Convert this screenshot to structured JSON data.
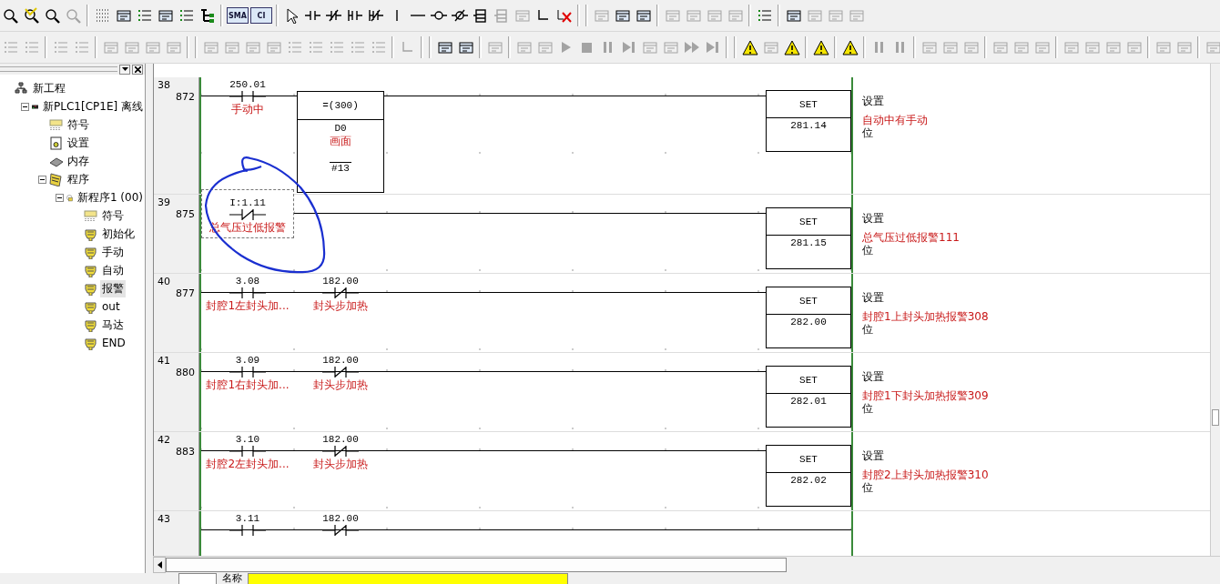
{
  "toolbars": [
    {
      "items": [
        {
          "kind": "magnifier",
          "disabled": false
        },
        {
          "kind": "find",
          "disabled": false
        },
        {
          "kind": "magnifier",
          "disabled": false
        },
        {
          "kind": "magnifier",
          "disabled": true
        },
        {
          "kind": "separator"
        },
        {
          "kind": "grid",
          "disabled": false
        },
        {
          "kind": "window",
          "disabled": false
        },
        {
          "kind": "list",
          "disabled": false
        },
        {
          "kind": "window",
          "disabled": false
        },
        {
          "kind": "list",
          "disabled": false
        },
        {
          "kind": "tree",
          "disabled": false
        },
        {
          "kind": "separator"
        },
        {
          "kind": "labeled",
          "label": "SMA",
          "disabled": false
        },
        {
          "kind": "labeled",
          "label": "CI",
          "disabled": false
        },
        {
          "kind": "separator"
        },
        {
          "kind": "pointer",
          "disabled": false
        },
        {
          "kind": "contact-no",
          "disabled": false
        },
        {
          "kind": "contact-nc",
          "disabled": false
        },
        {
          "kind": "contact-or-no",
          "disabled": false
        },
        {
          "kind": "contact-or-nc",
          "disabled": false
        },
        {
          "kind": "line-v",
          "disabled": false
        },
        {
          "kind": "line-h",
          "disabled": false
        },
        {
          "kind": "coil",
          "disabled": false
        },
        {
          "kind": "coil-nc",
          "disabled": false
        },
        {
          "kind": "instruction",
          "disabled": false
        },
        {
          "kind": "instruction",
          "disabled": true
        },
        {
          "kind": "window",
          "disabled": true
        },
        {
          "kind": "corner",
          "disabled": false
        },
        {
          "kind": "delete",
          "disabled": false
        },
        {
          "kind": "separator"
        },
        {
          "kind": "separator"
        },
        {
          "kind": "window",
          "disabled": true
        },
        {
          "kind": "window",
          "disabled": false
        },
        {
          "kind": "window",
          "disabled": false
        },
        {
          "kind": "separator"
        },
        {
          "kind": "window",
          "disabled": true
        },
        {
          "kind": "window",
          "disabled": true
        },
        {
          "kind": "window",
          "disabled": true
        },
        {
          "kind": "window",
          "disabled": true
        },
        {
          "kind": "separator"
        },
        {
          "kind": "list",
          "disabled": false
        },
        {
          "kind": "separator"
        },
        {
          "kind": "window",
          "disabled": false
        },
        {
          "kind": "window",
          "disabled": true
        },
        {
          "kind": "window",
          "disabled": true
        },
        {
          "kind": "window",
          "disabled": true
        }
      ]
    },
    {
      "items": [
        {
          "kind": "list",
          "disabled": true
        },
        {
          "kind": "list",
          "disabled": true
        },
        {
          "kind": "separator"
        },
        {
          "kind": "list",
          "disabled": true
        },
        {
          "kind": "list",
          "disabled": true
        },
        {
          "kind": "separator"
        },
        {
          "kind": "window",
          "disabled": true
        },
        {
          "kind": "window",
          "disabled": true
        },
        {
          "kind": "window",
          "disabled": true
        },
        {
          "kind": "window",
          "disabled": true
        },
        {
          "kind": "separator"
        },
        {
          "kind": "separator"
        },
        {
          "kind": "window",
          "disabled": true
        },
        {
          "kind": "window",
          "disabled": true
        },
        {
          "kind": "window",
          "disabled": true
        },
        {
          "kind": "window",
          "disabled": true
        },
        {
          "kind": "list",
          "disabled": true
        },
        {
          "kind": "list",
          "disabled": true
        },
        {
          "kind": "list",
          "disabled": true
        },
        {
          "kind": "list",
          "disabled": true
        },
        {
          "kind": "list",
          "disabled": true
        },
        {
          "kind": "separator"
        },
        {
          "kind": "corner",
          "disabled": true
        },
        {
          "kind": "separator"
        },
        {
          "kind": "separator"
        },
        {
          "kind": "window",
          "disabled": false
        },
        {
          "kind": "window",
          "disabled": false
        },
        {
          "kind": "separator"
        },
        {
          "kind": "window",
          "disabled": true
        },
        {
          "kind": "separator"
        },
        {
          "kind": "window",
          "disabled": true
        },
        {
          "kind": "window",
          "disabled": true
        },
        {
          "kind": "play",
          "disabled": true
        },
        {
          "kind": "stop",
          "disabled": true
        },
        {
          "kind": "pause",
          "disabled": true
        },
        {
          "kind": "step",
          "disabled": true
        },
        {
          "kind": "window",
          "disabled": true
        },
        {
          "kind": "window",
          "disabled": true
        },
        {
          "kind": "fast-forward",
          "disabled": true
        },
        {
          "kind": "step",
          "disabled": true
        },
        {
          "kind": "separator"
        },
        {
          "kind": "separator"
        },
        {
          "kind": "warning",
          "disabled": false
        },
        {
          "kind": "window",
          "disabled": true
        },
        {
          "kind": "warning",
          "disabled": false
        },
        {
          "kind": "separator"
        },
        {
          "kind": "warning",
          "disabled": false
        },
        {
          "kind": "separator"
        },
        {
          "kind": "warning",
          "disabled": false
        },
        {
          "kind": "separator"
        },
        {
          "kind": "pause",
          "disabled": true
        },
        {
          "kind": "pause",
          "disabled": true
        },
        {
          "kind": "separator"
        },
        {
          "kind": "window",
          "disabled": true
        },
        {
          "kind": "window",
          "disabled": true
        },
        {
          "kind": "window",
          "disabled": true
        },
        {
          "kind": "separator"
        },
        {
          "kind": "window",
          "disabled": true
        },
        {
          "kind": "window",
          "disabled": true
        },
        {
          "kind": "window",
          "disabled": true
        },
        {
          "kind": "separator"
        },
        {
          "kind": "window",
          "disabled": true
        },
        {
          "kind": "window",
          "disabled": true
        },
        {
          "kind": "window",
          "disabled": true
        },
        {
          "kind": "window",
          "disabled": true
        },
        {
          "kind": "separator"
        },
        {
          "kind": "window",
          "disabled": true
        },
        {
          "kind": "window",
          "disabled": true
        },
        {
          "kind": "separator"
        },
        {
          "kind": "window",
          "disabled": true
        }
      ]
    }
  ],
  "project_tree": [
    {
      "label": "新工程",
      "kind": "project",
      "selected": false,
      "children": [
        {
          "label": "新PLC1[CP1E] 离线",
          "kind": "plc",
          "expanded": true,
          "selected": false,
          "children": [
            {
              "label": "符号",
              "kind": "symbols",
              "selected": false
            },
            {
              "label": "设置",
              "kind": "settings",
              "selected": false
            },
            {
              "label": "内存",
              "kind": "memory",
              "selected": false
            },
            {
              "label": "程序",
              "kind": "programs",
              "expanded": true,
              "selected": false,
              "children": [
                {
                  "label": "新程序1 (00)",
                  "kind": "task",
                  "expanded": true,
                  "selected": false,
                  "children": [
                    {
                      "label": "符号",
                      "kind": "symbols",
                      "selected": false
                    },
                    {
                      "label": "初始化",
                      "kind": "section",
                      "selected": false
                    },
                    {
                      "label": "手动",
                      "kind": "section",
                      "selected": false
                    },
                    {
                      "label": "自动",
                      "kind": "section",
                      "selected": false
                    },
                    {
                      "label": "报警",
                      "kind": "section",
                      "selected": true
                    },
                    {
                      "label": "out",
                      "kind": "section",
                      "selected": false
                    },
                    {
                      "label": "马达",
                      "kind": "section",
                      "selected": false
                    },
                    {
                      "label": "END",
                      "kind": "section",
                      "selected": false
                    }
                  ]
                }
              ]
            }
          ]
        }
      ]
    }
  ],
  "ladder": {
    "rungs": [
      {
        "number": "38",
        "step": "872",
        "contacts": [
          {
            "address": "250.01",
            "comment": "手动中",
            "kind": "no",
            "selected": false
          }
        ],
        "compare": {
          "operator": "=(300)",
          "operand": "D0",
          "operand_comment": "画面",
          "value": "#13"
        },
        "output": {
          "instruction": "SET",
          "operand": "281.14"
        },
        "notes": [
          "设置",
          "自动中有手动",
          "位"
        ]
      },
      {
        "number": "39",
        "step": "875",
        "contacts": [
          {
            "address": "I:1.11",
            "comment": "总气压过低报警",
            "kind": "nc",
            "selected": true
          }
        ],
        "output": {
          "instruction": "SET",
          "operand": "281.15"
        },
        "notes": [
          "设置",
          "总气压过低报警111",
          "位"
        ]
      },
      {
        "number": "40",
        "step": "877",
        "contacts": [
          {
            "address": "3.08",
            "comment": "封腔1左封头加...",
            "kind": "no",
            "selected": false
          },
          {
            "address": "182.00",
            "comment": "封头步加热",
            "kind": "nc",
            "selected": false
          }
        ],
        "output": {
          "instruction": "SET",
          "operand": "282.00"
        },
        "notes": [
          "设置",
          "封腔1上封头加热报警308",
          "位"
        ]
      },
      {
        "number": "41",
        "step": "880",
        "contacts": [
          {
            "address": "3.09",
            "comment": "封腔1右封头加...",
            "kind": "no",
            "selected": false
          },
          {
            "address": "182.00",
            "comment": "封头步加热",
            "kind": "nc",
            "selected": false
          }
        ],
        "output": {
          "instruction": "SET",
          "operand": "282.01"
        },
        "notes": [
          "设置",
          "封腔1下封头加热报警309",
          "位"
        ]
      },
      {
        "number": "42",
        "step": "883",
        "contacts": [
          {
            "address": "3.10",
            "comment": "封腔2左封头加...",
            "kind": "no",
            "selected": false
          },
          {
            "address": "182.00",
            "comment": "封头步加热",
            "kind": "nc",
            "selected": false
          }
        ],
        "output": {
          "instruction": "SET",
          "operand": "282.02"
        },
        "notes": [
          "设置",
          "封腔2上封头加热报警310",
          "位"
        ]
      },
      {
        "number": "43",
        "contacts": [
          {
            "address": "3.11",
            "kind": "no",
            "selected": false
          },
          {
            "address": "182.00",
            "kind": "nc",
            "selected": false
          }
        ]
      }
    ]
  },
  "bottom_bar": {
    "name_label": "名称"
  }
}
